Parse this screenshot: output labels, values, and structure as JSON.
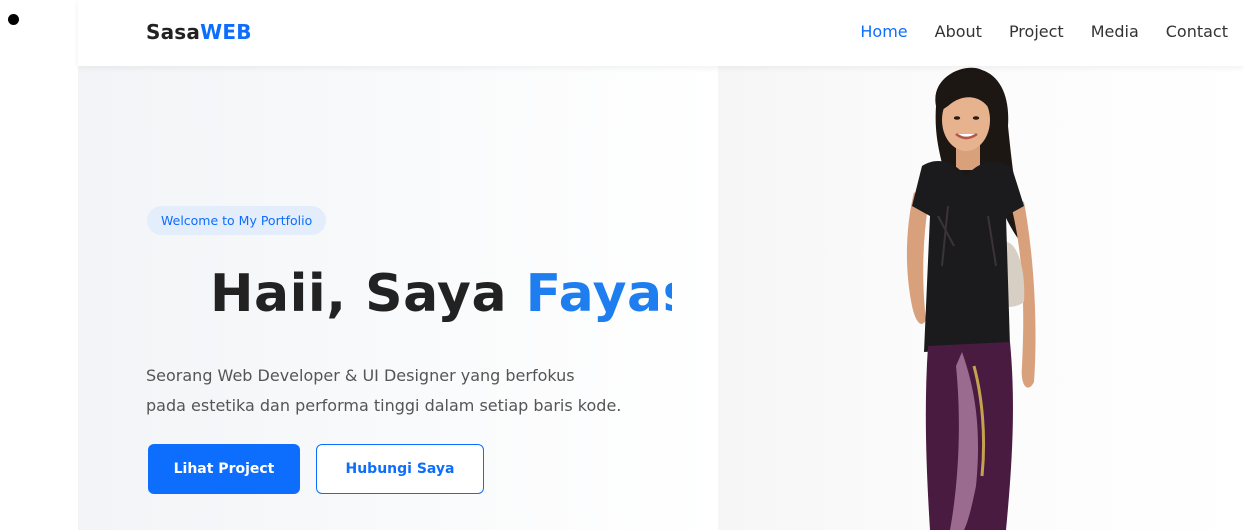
{
  "brand": {
    "prefix": "Sasa",
    "accent": "WEB"
  },
  "nav": {
    "items": [
      {
        "label": "Home",
        "active": true
      },
      {
        "label": "About",
        "active": false
      },
      {
        "label": "Project",
        "active": false
      },
      {
        "label": "Media",
        "active": false
      },
      {
        "label": "Contact",
        "active": false
      }
    ]
  },
  "hero": {
    "badge": "Welcome to My Portfolio",
    "greeting": "Haii, Saya ",
    "name": "Fayas",
    "description_line1": "Seorang Web Developer & UI Designer yang berfokus",
    "description_line2": "pada estetika dan performa tinggi dalam setiap baris kode.",
    "primary_button": "Lihat Project",
    "secondary_button": "Hubungi Saya"
  },
  "colors": {
    "accent": "#0d6efd",
    "text_dark": "#222222",
    "badge_bg": "#e3edfb"
  },
  "icons": {
    "stray_bullet": "bullet-dot-icon",
    "portrait": "woman-illustration"
  }
}
